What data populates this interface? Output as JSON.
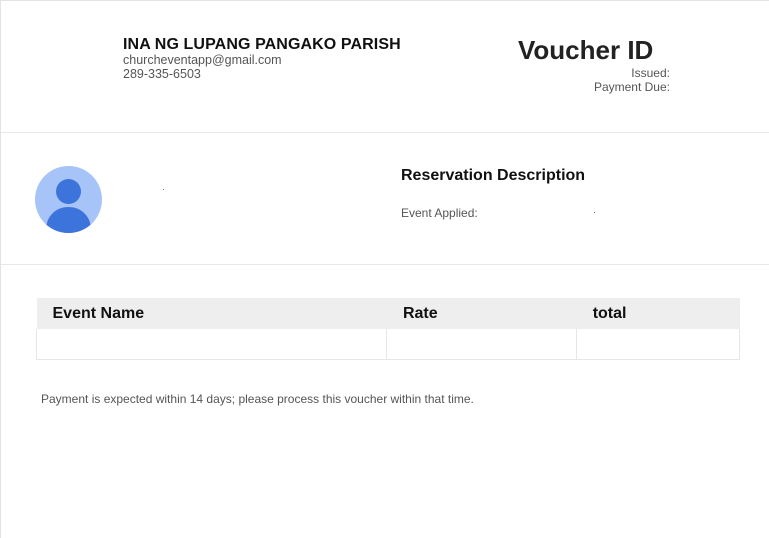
{
  "header": {
    "org_name": "INA NG LUPANG PANGAKO PARISH",
    "email": "churcheventapp@gmail.com",
    "phone": "289-335-6503",
    "voucher_title": "Voucher ID",
    "issued_label": "Issued:",
    "payment_due_label": "Payment Due:"
  },
  "reservation": {
    "title": "Reservation Description",
    "event_applied_label": "Event Applied:"
  },
  "table": {
    "columns": [
      "Event Name",
      "Rate",
      "total"
    ],
    "rows": [
      [
        "",
        "",
        ""
      ]
    ]
  },
  "footer": {
    "note": "Payment is expected within 14 days; please process this voucher within that time."
  },
  "colors": {
    "avatar_bg": "#a6c4f7",
    "avatar_fg": "#3d74db",
    "table_header_bg": "#eeeeee"
  }
}
